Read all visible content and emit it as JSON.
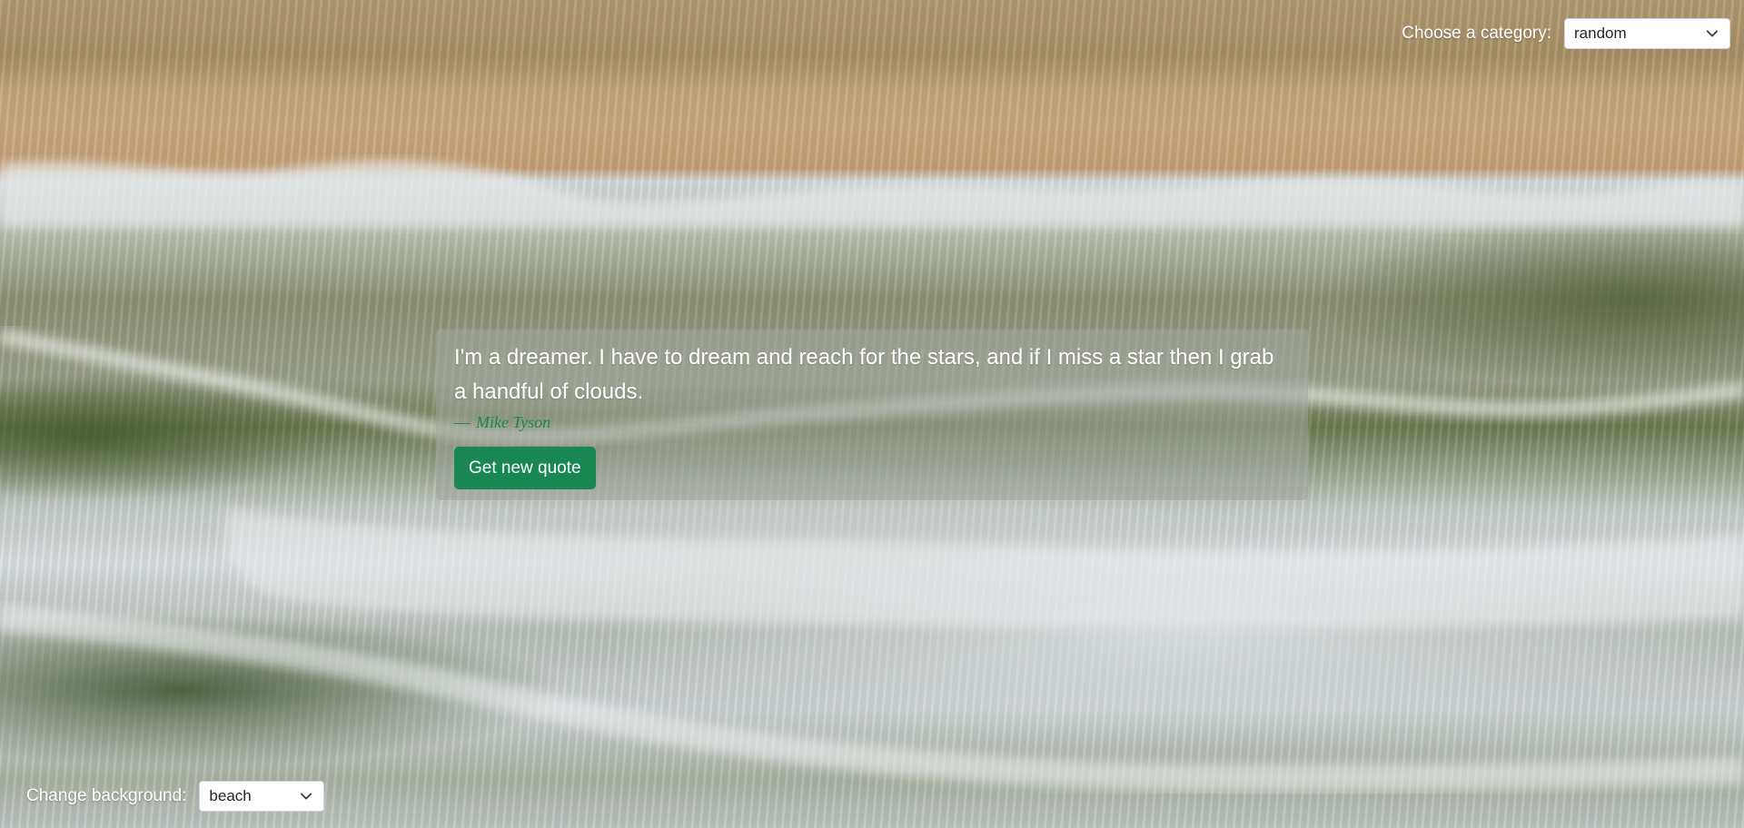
{
  "background": {
    "scene": "aerial beach with waves",
    "colors": {
      "sand": "#c3a57c",
      "foam": "#d9dee0",
      "water": "#6c7a4f"
    }
  },
  "category": {
    "label": "Choose a category:",
    "selected": "random",
    "icon": "chevron-down-icon"
  },
  "quote": {
    "text": "I'm a dreamer. I have to dream and reach for the stars, and if I miss a star then I grab a handful of clouds.",
    "author_prefix": "—",
    "author": "Mike Tyson",
    "button_label": "Get new quote",
    "accent_color": "#198754"
  },
  "background_picker": {
    "label": "Change background:",
    "selected": "beach",
    "icon": "chevron-down-icon"
  }
}
